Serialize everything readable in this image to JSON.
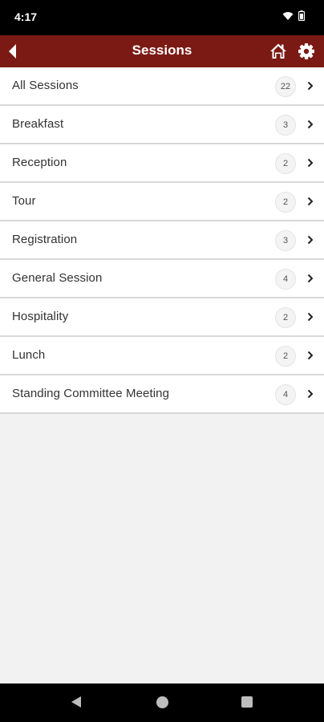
{
  "status": {
    "time": "4:17"
  },
  "header": {
    "title": "Sessions"
  },
  "sessions": [
    {
      "label": "All Sessions",
      "count": "22"
    },
    {
      "label": "Breakfast",
      "count": "3"
    },
    {
      "label": "Reception",
      "count": "2"
    },
    {
      "label": "Tour",
      "count": "2"
    },
    {
      "label": "Registration",
      "count": "3"
    },
    {
      "label": "General Session",
      "count": "4"
    },
    {
      "label": "Hospitality",
      "count": "2"
    },
    {
      "label": "Lunch",
      "count": "2"
    },
    {
      "label": "Standing Committee Meeting",
      "count": "4"
    }
  ],
  "icons": {
    "back": "back-arrow-icon",
    "home": "home-icon",
    "settings": "gear-icon",
    "chevron": "chevron-right-icon"
  },
  "colors": {
    "header": "#7b1a14",
    "background": "#f2f2f2"
  }
}
